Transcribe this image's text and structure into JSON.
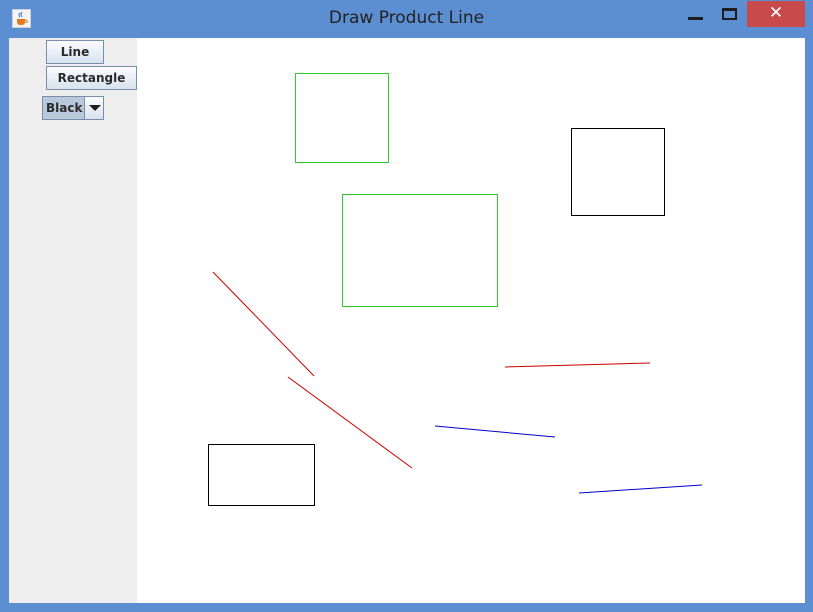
{
  "window": {
    "title": "Draw Product Line",
    "close_glyph": "✕"
  },
  "toolbar": {
    "line_label": "Line",
    "rectangle_label": "Rectangle",
    "color_select_value": "Black"
  },
  "icons": {
    "app": "java-cup-icon",
    "minimize": "minimize-icon",
    "maximize": "maximize-icon",
    "close": "close-icon",
    "dropdown": "chevron-down-icon"
  },
  "colors": {
    "green": "#2ecc2e",
    "black": "#000000",
    "red": "#cc0000",
    "blue": "#0000cc"
  }
}
